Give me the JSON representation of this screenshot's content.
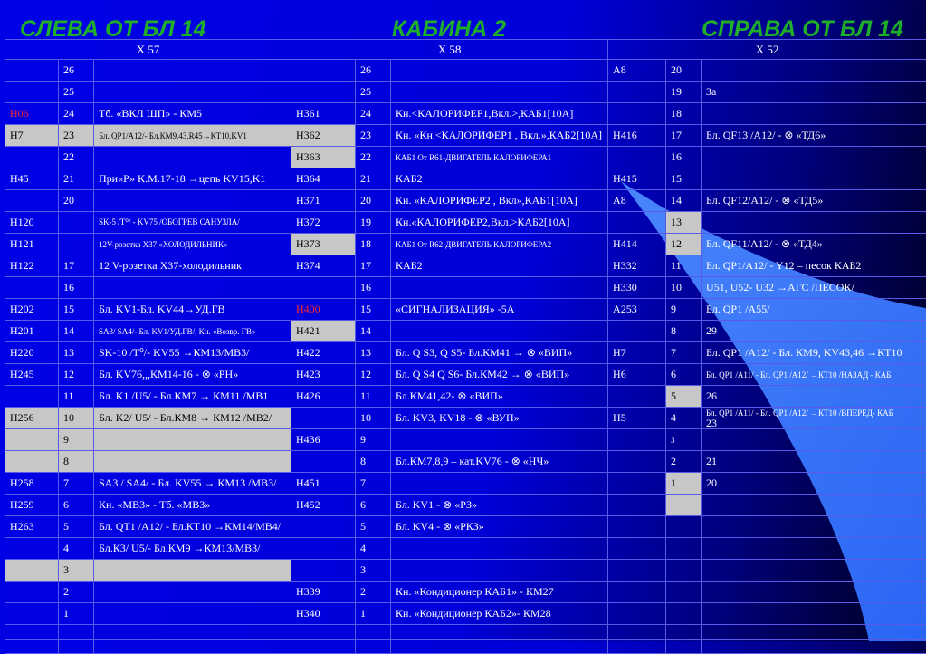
{
  "headers": {
    "left": "СЛЕВА ОТ БЛ 14",
    "middle": "КАБИНА 2",
    "right": "СПРАВА ОТ БЛ 14"
  },
  "connectors": {
    "x57": "X 57",
    "x58": "X 58",
    "x52": "X 52"
  },
  "rows": [
    [
      "",
      "26",
      "",
      "",
      "26",
      "",
      "А8",
      "20",
      ""
    ],
    [
      "",
      "25",
      "",
      "",
      "25",
      "",
      "",
      "19",
      "3а"
    ],
    [
      "Н06",
      "24",
      "Тб. «ВКЛ ШП» - КМ5",
      "Н361",
      "24",
      "Кн.<КАЛОРИФЕР1,Вкл.>,КАБ1[10А]",
      "",
      "18",
      ""
    ],
    [
      "Н7",
      "23",
      "Бл. QP1/A12/- Бл.КМ9,43,R45→КТ10,KV1",
      "Н362",
      "23",
      " Кн. «Кн.<КАЛОРИФЕР1 , Вкл.»,КАБ2[10А]",
      "Н416",
      "17",
      "Бл. QF13 /A12/   -      ⊗       «ТД6»"
    ],
    [
      "",
      "22",
      "",
      "Н363",
      "22",
      "КАБ1    От R61-ДВИГАТЕЛЬ   КАЛОРИФЕРА1",
      "",
      "16",
      ""
    ],
    [
      "Н45",
      "21",
      "При«Р» К.М.17-18 →цепь KV15,K1",
      "Н364",
      "21",
      "КАБ2",
      "Н415",
      "15",
      ""
    ],
    [
      "",
      "20",
      "",
      "Н371",
      "20",
      "Кн. «КАЛОРИФЕР2 , Вкл»,КАБ1[10А]",
      "А8",
      "14",
      "Бл. QF12/A12/   -      ⊗       «ТД5»"
    ],
    [
      "Н120",
      "",
      "SK-5 /Т⁰/ - KV75 /ОБОГРЕВ САНУЗЛА/",
      "Н372",
      "19",
      "Кн.«КАЛОРИФЕР2,Вкл.>КАБ2[10А]",
      "",
      "13",
      ""
    ],
    [
      "Н121",
      "",
      " 12V-розетка X37 «ХОЛОДИЛЬНИК»",
      "Н373",
      "18",
      "КАБ1      От R62-ДВИГАТЕЛЬ             КАЛОРИФЕРА2",
      "Н414",
      "12",
      "Бл. QF11/A12/   -     ⊗     «ТД4»"
    ],
    [
      "Н122",
      "17",
      " 12 V-розетка X37-холодильник",
      "Н374",
      "17",
      "КАБ2",
      "Н332",
      "11",
      "Бл. QP1/A12/  - Y12 – песок КАБ2"
    ],
    [
      "",
      "16",
      "",
      "",
      "16",
      "",
      "Н330",
      "10",
      "U51, U52- U32 →АГС /ПЕСОК/"
    ],
    [
      "Н202",
      "15",
      "Бл. KV1-Бл. KV44→УД.ГВ",
      "Н400",
      "15",
      "«СИГНАЛИЗАЦИЯ» -5А",
      "А253",
      "9",
      "Бл. QP1  /A55/"
    ],
    [
      "Н201",
      "14",
      "SA3/ SA4/- Бл. KV1/УД.ГВ/,  Кн. «Возвр. ГВ»",
      "Н421",
      "14",
      "",
      "",
      "8",
      "29"
    ],
    [
      "Н220",
      "13",
      "SK-10 /Т⁰/- KV55 →КМ13/МВ3/",
      "Н422",
      "13",
      "Бл. Q S3, Q S5- Бл.КМ41 →  ⊗  «ВИП»",
      "Н7",
      "7",
      "Бл. QP1  /A12/ - Бл. КМ9, KV43,46 →КТ10"
    ],
    [
      "Н245",
      "12",
      "",
      "Н423",
      "12",
      "Бл. Q S4 Q S6- Бл.КМ42 →  ⊗ «ВИП»",
      "Н6",
      "6",
      "Бл. QP1  /A11/ - Бл. QP1 /A12/ →КТ10 /НАЗАД  - КАБ"
    ],
    [
      "",
      "11",
      "Бл. K1 /U5/ -  Бл.КМ7 →         КМ11 /МВ1",
      "Н426",
      "11",
      "Бл.КМ41,42-    ⊗    «ВИП»",
      "",
      "5",
      "26"
    ],
    [
      "Н256",
      "10",
      "Бл. K2/ U5/ -    Бл.КМ8 →   КМ12 /МВ2/",
      "",
      "10",
      "Бл. KV3, KV18 - ⊗  «ВУП»",
      "Н5",
      "4",
      "Бл. QP1  /A11/  - Бл. QP1 /A12/ →КТ10 /ВПЕРЁД- КАБ"
    ],
    [
      "",
      "9",
      "",
      "Н436",
      "9",
      "",
      "",
      "3",
      ""
    ],
    [
      "",
      "8",
      "",
      "",
      "8",
      "Бл.КМ7,8,9 – кат.KV76  -  ⊗   «НЧ»",
      "",
      "2",
      "21"
    ],
    [
      "Н258",
      "7",
      "SA3 / SA4/  -  Бл. KV55 →  КМ13 /МВ3/",
      "Н451",
      "7",
      "",
      "",
      "1",
      "20"
    ],
    [
      "Н259",
      "6",
      "Кн. «МВ3»  - Тб. «МВ3»",
      "Н452",
      "6",
      "Бл. KV1 -  ⊗    «РЗ»",
      "",
      "",
      ""
    ],
    [
      "Н263",
      "5",
      "Бл. QT1 /A12/ - Бл.КТ10 →КМ14/МВ4/",
      "",
      "5",
      "Бл. KV4 -  ⊗   «РКЗ»",
      "",
      "",
      ""
    ],
    [
      "",
      "4",
      "Бл.К3/ U5/- Бл.КМ9 →КМ13/МВ3/",
      "",
      "4",
      "",
      "",
      "",
      ""
    ],
    [
      "",
      "3",
      "",
      "",
      "3",
      "",
      "",
      "",
      ""
    ],
    [
      "",
      "2",
      "",
      "Н339",
      "2",
      "Кн. «Кондиционер КАБ1» - КМ27",
      "",
      "",
      ""
    ],
    [
      "",
      "1",
      "",
      "Н340",
      "1",
      "Кн. «Кондиционер КАБ2»- КМ28",
      "",
      "",
      ""
    ],
    [
      "",
      "",
      "",
      "",
      "",
      "",
      "",
      "",
      ""
    ],
    [
      "",
      "",
      "",
      "",
      "",
      "",
      "",
      "",
      ""
    ]
  ],
  "extra_labels": {
    "x57_row12_13": "Бл. KV76,,,КМ14-16 -  ⊗  «РН»",
    "x52_row3_4": "23"
  },
  "colors": {
    "header_text": "#1fae2a",
    "background": "#0000e6",
    "gray_cell": "#c7c7c7",
    "red_text": "#ff2a2a"
  }
}
